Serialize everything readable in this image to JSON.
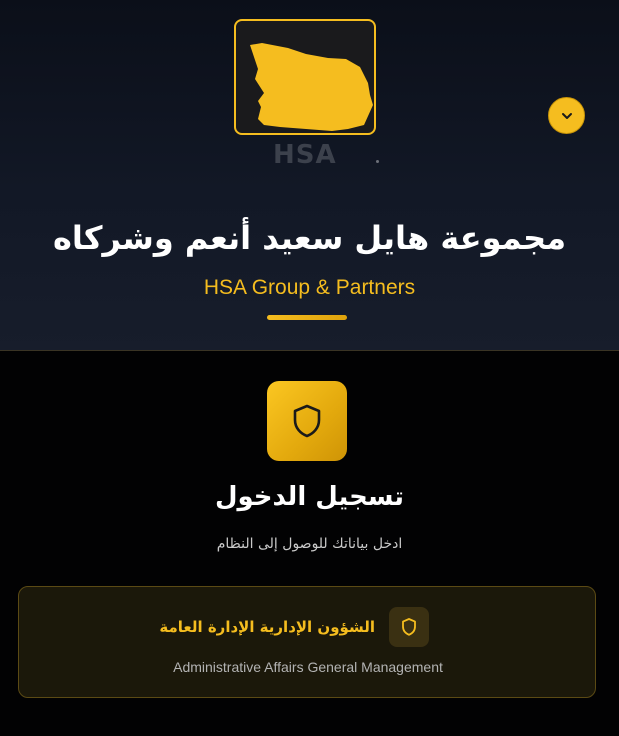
{
  "header": {
    "logo": {
      "name": "hsa-logo",
      "ghost_text": "HSA"
    },
    "toggle_icon": "chevron-down-icon",
    "title_ar": "مجموعة هايل سعيد أنعم وشركاه",
    "title_en": "HSA Group & Partners"
  },
  "login": {
    "icon": "shield-icon",
    "title": "تسجيل الدخول",
    "subtitle": "ادخل بياناتك للوصول إلى النظام"
  },
  "department": {
    "icon": "shield-icon",
    "name_ar": "الشؤون الإدارية الإدارة العامة",
    "name_en": "Administrative Affairs General Management"
  },
  "colors": {
    "accent": "#f5bd1f",
    "header_bg": "#121826",
    "body_bg": "#020203",
    "card_bg": "#1b180a",
    "card_border": "#5b4a14"
  }
}
